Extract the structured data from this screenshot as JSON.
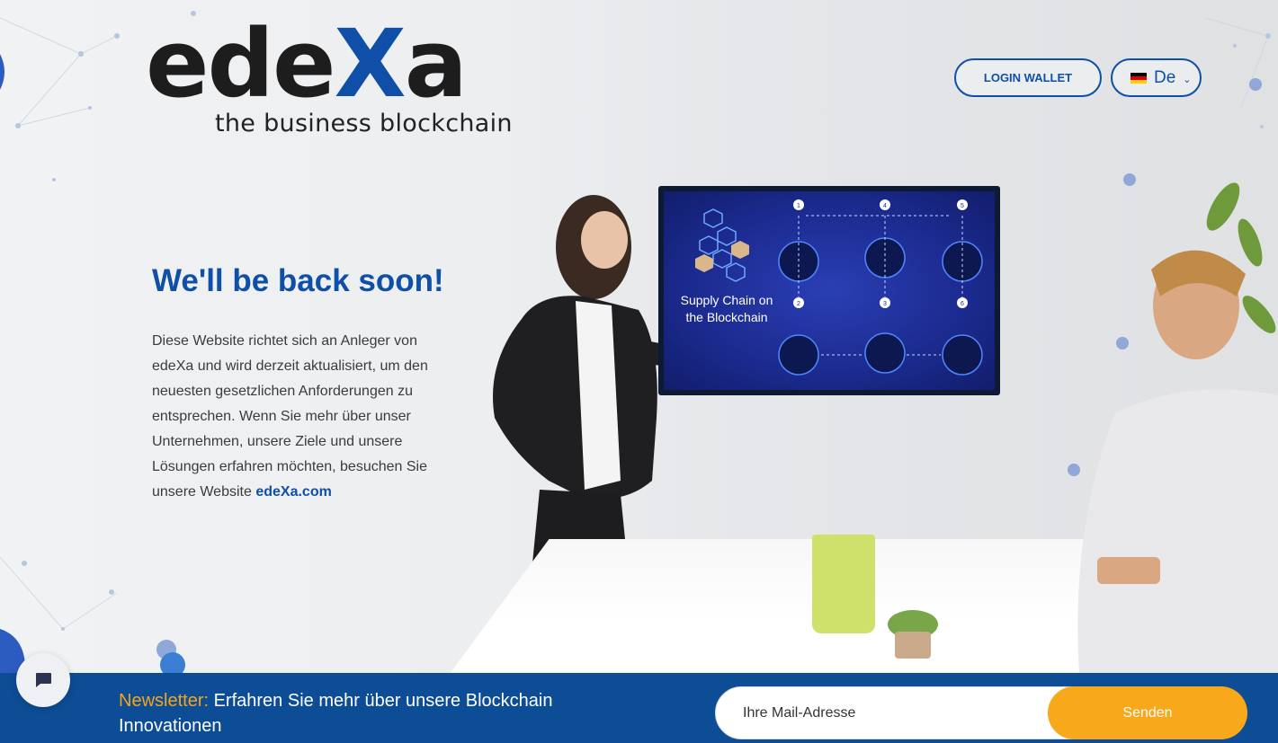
{
  "logo": {
    "word_prefix": "ede",
    "word_x": "X",
    "word_suffix": "a",
    "tagline": "the business blockchain"
  },
  "header": {
    "login_label": "LOGIN WALLET",
    "language_label": "De",
    "flag_colors": [
      "#000000",
      "#dd0000",
      "#ffce00"
    ]
  },
  "main": {
    "headline": "We'll be back soon!",
    "body": "Diese Website richtet sich an Anleger von edeXa und wird derzeit aktualisiert, um den neuesten gesetzlichen Anforderungen zu entsprechen. Wenn Sie mehr über unser Unternehmen, unsere Ziele und unsere Lösungen erfahren möchten, besuchen Sie unsere Website",
    "link_text": "edeXa.com"
  },
  "tv": {
    "title": "Supply Chain on the Blockchain",
    "steps": [
      "1",
      "4",
      "5",
      "2",
      "3",
      "6"
    ]
  },
  "newsletter": {
    "lead": "Newsletter:",
    "text": "Erfahren Sie mehr über unsere Blockchain Innovationen",
    "placeholder": "Ihre Mail-Adresse",
    "button_label": "Senden"
  },
  "colors": {
    "brand_blue": "#0f4fa8",
    "newsletter_bg": "#0d4d95",
    "accent_orange": "#f7a81b"
  }
}
